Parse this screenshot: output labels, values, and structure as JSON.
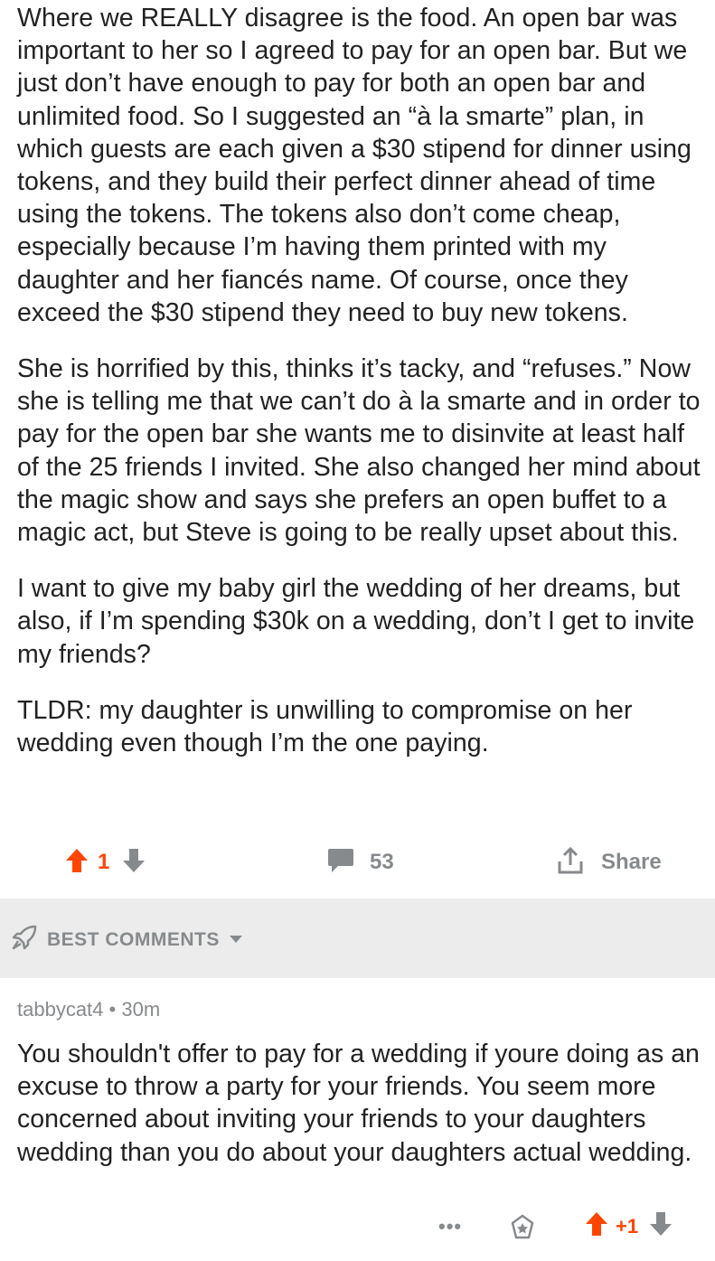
{
  "post": {
    "paragraphs": [
      "Where we REALLY disagree is the food. An open bar was important to her so I agreed to pay for an open bar. But we just don’t have enough to pay for both an open bar and unlimited food. So I suggested an “à la smarte” plan, in which guests are each given a $30 stipend for dinner using tokens, and they build their perfect dinner ahead of time using the tokens. The tokens also don’t come cheap, especially because I’m having them printed with my daughter and her fiancés name.  Of course, once they exceed the $30 stipend they need to buy new tokens.",
      "She is horrified by this, thinks it’s tacky, and “refuses.” Now she is telling me that we can’t do à la smarte and in order to pay for the open bar she wants me to disinvite at least half of the 25 friends I invited. She also changed her mind about the magic show and says she prefers an open buffet to a magic act, but Steve is going to be really upset about this.",
      "I want to give my baby girl the wedding of her dreams, but also, if I’m spending $30k on a wedding, don’t I get to invite my friends?",
      "TLDR: my daughter is unwilling to compromise on her wedding even though I’m the one paying."
    ],
    "score": "1",
    "comment_count": "53",
    "share_label": "Share"
  },
  "best_comments": {
    "label": "BEST COMMENTS"
  },
  "comment": {
    "author": "tabbycat4",
    "separator": "•",
    "age": "30m",
    "text": "You shouldn't offer to pay for a wedding if youre doing as an excuse to throw a party for your friends. You seem more concerned about inviting your friends to your daughters wedding than you do about your daughters actual wedding.",
    "more": "•••",
    "score": "+1"
  },
  "colors": {
    "upvote": "#ff4500",
    "muted": "#878a8c",
    "bar_background": "#ececec",
    "text": "#222222"
  },
  "icons": [
    "upvote-arrow-icon",
    "downvote-arrow-icon",
    "comment-bubble-icon",
    "share-icon",
    "rocket-icon",
    "chevron-down-icon",
    "more-icon",
    "award-icon"
  ]
}
